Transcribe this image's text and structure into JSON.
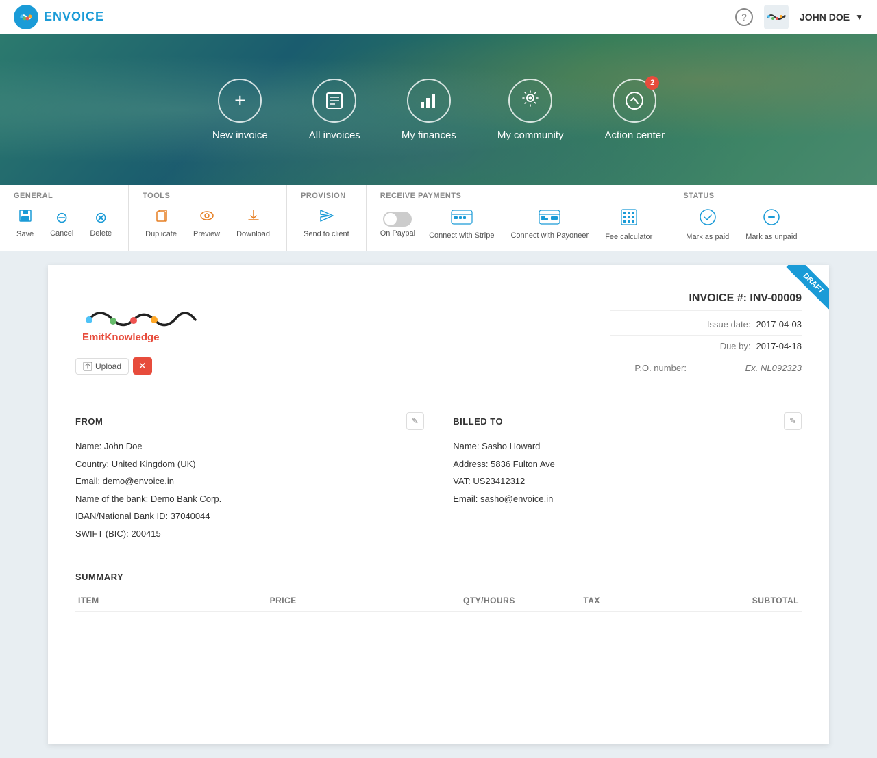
{
  "app": {
    "name": "ENVOICE"
  },
  "header": {
    "help_label": "?",
    "user_name": "JOHN DOE",
    "logo_initial": "e"
  },
  "nav": {
    "items": [
      {
        "id": "new-invoice",
        "label": "New invoice",
        "icon": "+"
      },
      {
        "id": "all-invoices",
        "label": "All invoices",
        "icon": "▤"
      },
      {
        "id": "my-finances",
        "label": "My finances",
        "icon": "📊"
      },
      {
        "id": "my-community",
        "label": "My community",
        "icon": "💡"
      },
      {
        "id": "action-center",
        "label": "Action center",
        "icon": "◎",
        "badge": "2"
      }
    ]
  },
  "toolbar": {
    "sections": {
      "general": {
        "label": "GENERAL",
        "actions": [
          {
            "id": "save",
            "label": "Save",
            "icon": "💾"
          },
          {
            "id": "cancel",
            "label": "Cancel",
            "icon": "⊖"
          },
          {
            "id": "delete",
            "label": "Delete",
            "icon": "⊗"
          }
        ]
      },
      "tools": {
        "label": "TOOLS",
        "actions": [
          {
            "id": "duplicate",
            "label": "Duplicate",
            "icon": "⧉"
          },
          {
            "id": "preview",
            "label": "Preview",
            "icon": "👁"
          },
          {
            "id": "download",
            "label": "Download",
            "icon": "⬇"
          }
        ]
      },
      "provision": {
        "label": "PROVISION",
        "actions": [
          {
            "id": "send-client",
            "label": "Send to client",
            "icon": "✈"
          }
        ]
      },
      "receive_payments": {
        "label": "RECEIVE PAYMENTS",
        "actions": [
          {
            "id": "on-paypal",
            "label": "On Paypal"
          },
          {
            "id": "connect-stripe",
            "label": "Connect with Stripe",
            "icon": "💳"
          },
          {
            "id": "connect-payoneer",
            "label": "Connect with Payoneer",
            "icon": "💳"
          },
          {
            "id": "fee-calculator",
            "label": "Fee calculator",
            "icon": "⊞"
          }
        ]
      },
      "status": {
        "label": "STATUS",
        "actions": [
          {
            "id": "mark-paid",
            "label": "Mark as paid",
            "icon": "✓"
          },
          {
            "id": "mark-unpaid",
            "label": "Mark as unpaid",
            "icon": "⊖"
          }
        ]
      }
    }
  },
  "invoice": {
    "draft_label": "DRAFT",
    "number_label": "INVOICE #:",
    "number": "INV-00009",
    "issue_date_label": "Issue date:",
    "issue_date": "2017-04-03",
    "due_by_label": "Due by:",
    "due_by": "2017-04-18",
    "po_number_label": "P.O. number:",
    "po_placeholder": "Ex. NL092323",
    "from": {
      "title": "FROM",
      "name_label": "Name:",
      "name": "John Doe",
      "country_label": "Country:",
      "country": "United Kingdom (UK)",
      "email_label": "Email:",
      "email": "demo@envoice.in",
      "bank_label": "Name of the bank:",
      "bank": "Demo Bank Corp.",
      "iban_label": "IBAN/National Bank ID:",
      "iban": "37040044",
      "swift_label": "SWIFT (BIC):",
      "swift": "200415"
    },
    "billed_to": {
      "title": "BILLED TO",
      "name_label": "Name:",
      "name": "Sasho Howard",
      "address_label": "Address:",
      "address": "5836 Fulton Ave",
      "vat_label": "VAT:",
      "vat": "US23412312",
      "email_label": "Email:",
      "email": "sasho@envoice.in"
    },
    "summary": {
      "title": "SUMMARY",
      "columns": [
        "ITEM",
        "PRICE",
        "QTY/HOURS",
        "TAX",
        "SUBTOTAL"
      ]
    },
    "company_name": "EmitKnowledge",
    "upload_label": "Upload"
  }
}
